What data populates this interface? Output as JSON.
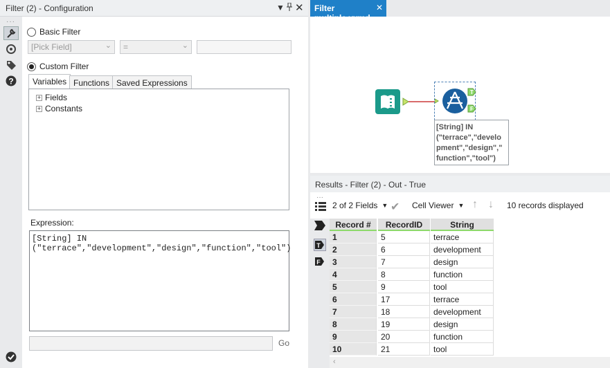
{
  "config_panel": {
    "title": "Filter (2) - Configuration",
    "basic_filter_label": "Basic Filter",
    "pick_field_placeholder": "[Pick Field]",
    "operator_value": "=",
    "custom_filter_label": "Custom Filter",
    "tabs": [
      "Variables",
      "Functions",
      "Saved Expressions"
    ],
    "tree_items": [
      "Fields",
      "Constants"
    ],
    "expression_label": "Expression:",
    "expression_text": "[String] IN\n(\"terrace\",\"development\",\"design\",\"function\",\"tool\")",
    "go_label": "Go"
  },
  "document": {
    "tab_title": "Filter multiple.yxmd",
    "annotation": "[String] IN (\"terrace\",\"develo pment\",\"design\",\" function\",\"tool\")",
    "anchor_true": "T",
    "anchor_false": "F"
  },
  "results": {
    "title": "Results - Filter (2) - Out - True",
    "fields_selector": "2 of 2 Fields",
    "cell_viewer": "Cell Viewer",
    "records_displayed": "10 records displayed",
    "columns": [
      "Record #",
      "RecordID",
      "String"
    ],
    "rows": [
      [
        "1",
        "5",
        "terrace"
      ],
      [
        "2",
        "6",
        "development"
      ],
      [
        "3",
        "7",
        "design"
      ],
      [
        "4",
        "8",
        "function"
      ],
      [
        "5",
        "9",
        "tool"
      ],
      [
        "6",
        "17",
        "terrace"
      ],
      [
        "7",
        "18",
        "development"
      ],
      [
        "8",
        "19",
        "design"
      ],
      [
        "9",
        "20",
        "function"
      ],
      [
        "10",
        "21",
        "tool"
      ]
    ]
  },
  "colors": {
    "accent": "#1f80c8",
    "filter_tool": "#1a5f9e",
    "input_tool": "#1b9a8a",
    "header_underline": "#8dd96a"
  }
}
